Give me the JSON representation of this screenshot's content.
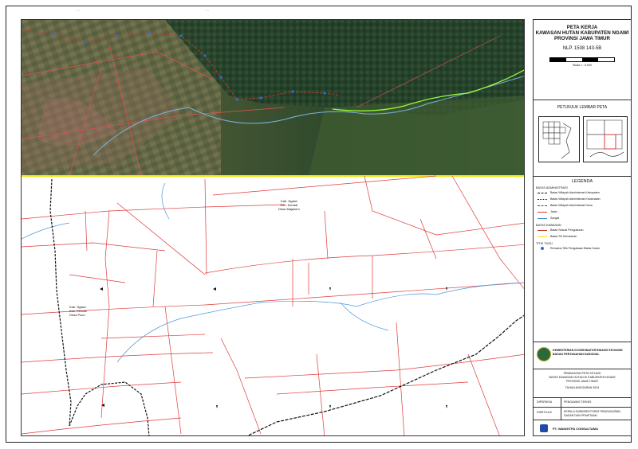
{
  "title": {
    "line1": "PETA KERJA",
    "line2": "KAWASAN HUTAN KABUPATEN NGAWI",
    "line3": "PROVINSI JAWA TIMUR",
    "nlp": "NLP. 1508 143-5B",
    "scale_text": "Skala 1 : 5.000"
  },
  "index_map": {
    "label": "PETUNJUK LEMBAR PETA"
  },
  "legend": {
    "title": "LEGENDA",
    "admin_header": "BATAS ADMINISTRASI",
    "admin_items": [
      "Batas Wilayah Administrasi Kabupaten",
      "Batas Wilayah Administrasi Kecamatan",
      "Batas Wilayah Administrasi Desa",
      "Jalan",
      "Sungai"
    ],
    "kawasan_header": "BATAS KAWASAN",
    "kawasan_items": [
      "Batas Sesuai Pengukuran",
      "Batas SK Kehutanan"
    ],
    "titik_header": "TITIK TUGU",
    "titik_items": [
      "Rencana Titik Pengadaan Batas Hutan"
    ]
  },
  "institution": {
    "line1": "KEMENTERIAN KOORDINATOR BIDANG EKONOMI",
    "line2": "BADAN PERTANAHAN NASIONAL"
  },
  "project": {
    "line1": "PEMBUATAN PETA SITUASI",
    "line2": "BATAS KAWASAN HUTAN DI KABUPATEN NGAWI",
    "line3": "PROVINSI JAWA TIMUR",
    "year": "TAHUN ANGGARAN 2024"
  },
  "signatures": [
    {
      "role": "DIPERIKSA",
      "name": "PENGAWAS TEKNIS"
    },
    {
      "role": "DISETUJUI",
      "name": "KEPALA SUBDIREKTORAT PENGUKURAN DASAR DAN PEMETAAN"
    }
  ],
  "company": "PT. WANGITPA CONSULTAMA",
  "map_labels": {
    "village_top": [
      "Kab. Ngawi",
      "Kec. Kendal",
      "Desa Majasem"
    ],
    "village_left": [
      "Kab. Ngawi",
      "Kec. Kendal",
      "Desa Pucu"
    ]
  },
  "colors": {
    "road": "#e03a3a",
    "river": "#3a8fd9",
    "admin_boundary": "#111111",
    "forest_boundary": "#f2e600",
    "stream_green": "#9cff3a",
    "point": "#2a6fd6"
  }
}
